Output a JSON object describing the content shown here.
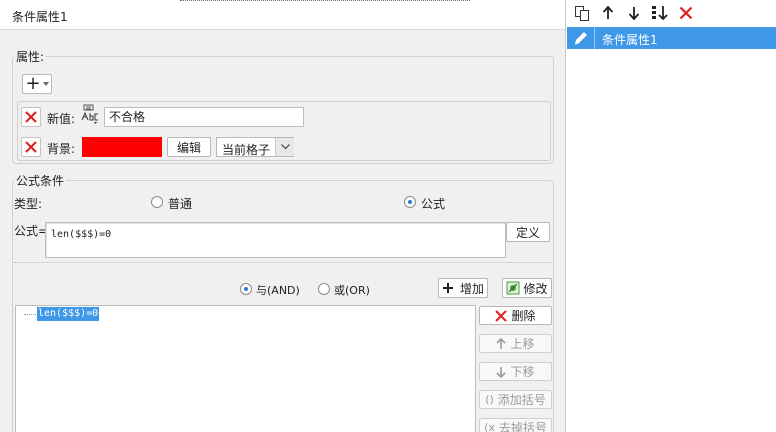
{
  "title": "条件属性1",
  "attributes": {
    "group_label": "属性:",
    "add_symbol": "+",
    "new_value_label": "新值:",
    "new_value": "不合格",
    "background_label": "背景:",
    "background_color": "#ff0000",
    "edit_label": "编辑",
    "scope_value": "当前格子"
  },
  "formula_condition": {
    "group_label": "公式条件",
    "type_label": "类型:",
    "type_normal": "普通",
    "type_formula": "公式",
    "selected_type": "公式",
    "formula_label": "公式=",
    "formula_value": "len($$$)=0",
    "define_label": "定义",
    "and_label": "与(AND)",
    "or_label": "或(OR)",
    "selected_logic": "与(AND)",
    "add_label": "增加",
    "modify_label": "修改",
    "conditions": [
      "len($$$)=0"
    ],
    "delete_label": "删除",
    "move_up_label": "上移",
    "move_down_label": "下移",
    "add_bracket_label": "添加括号",
    "remove_bracket_label": "去掉括号"
  },
  "right_panel": {
    "items": [
      "条件属性1"
    ],
    "selected_index": 0
  },
  "colors": {
    "accent": "#3f97e8",
    "danger": "#e02020"
  }
}
